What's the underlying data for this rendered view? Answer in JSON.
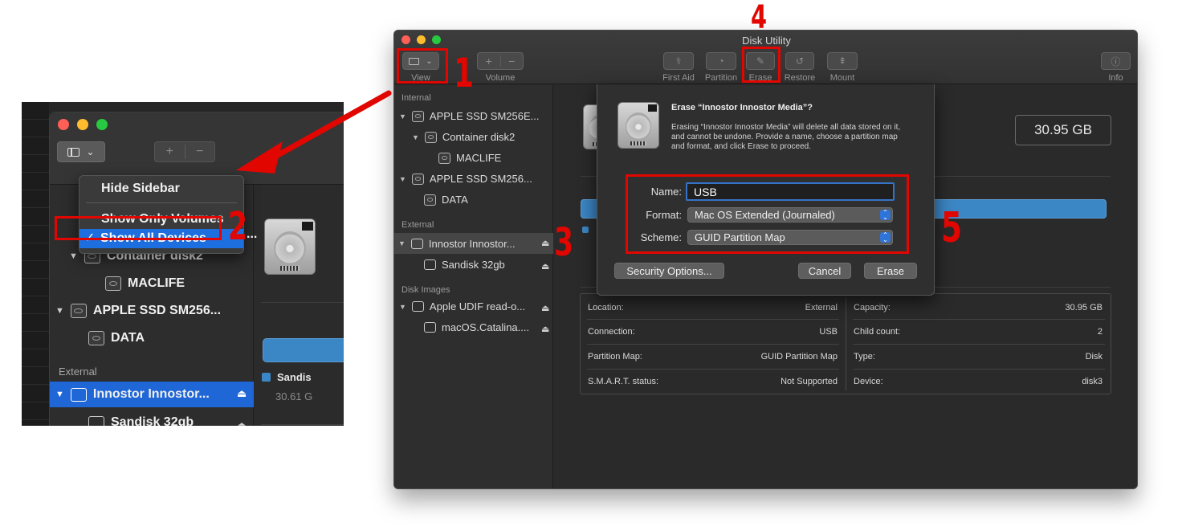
{
  "zoom": {
    "menu": {
      "items": [
        "Hide Sidebar",
        "Show Only Volumes",
        "Show All Devices"
      ],
      "checkmark": "✓"
    },
    "sidebar": {
      "items": [
        {
          "label": "Container disk2"
        },
        {
          "label": "MACLIFE"
        },
        {
          "label": "APPLE SSD SM256..."
        },
        {
          "label": "DATA"
        }
      ],
      "external_header": "External",
      "external_items": [
        {
          "label": "Innostor Innostor..."
        },
        {
          "label": "Sandisk 32gb"
        }
      ],
      "ellipsis": "..."
    },
    "content": {
      "volume_label": "Sandis",
      "size_partial": "30.61 G"
    }
  },
  "window": {
    "title": "Disk Utility",
    "toolbar": {
      "view_label": "View",
      "volume_label": "Volume",
      "plus": "+",
      "minus": "−",
      "first_aid": "First Aid",
      "partition": "Partition",
      "erase": "Erase",
      "restore": "Restore",
      "mount": "Mount",
      "info": "Info"
    },
    "sidebar": {
      "internal_header": "Internal",
      "internal_items": [
        {
          "label": "APPLE SSD SM256E..."
        },
        {
          "label": "Container disk2"
        },
        {
          "label": "MACLIFE"
        },
        {
          "label": "APPLE SSD SM256..."
        },
        {
          "label": "DATA"
        }
      ],
      "external_header": "External",
      "external_items": [
        {
          "label": "Innostor Innostor..."
        },
        {
          "label": "Sandisk 32gb"
        }
      ],
      "images_header": "Disk Images",
      "image_items": [
        {
          "label": "Apple UDIF read-o..."
        },
        {
          "label": "macOS.Catalina...."
        }
      ]
    },
    "content": {
      "capacity_box": "30.95 GB",
      "info": [
        {
          "label": "Location:",
          "value": "External",
          "label2": "Capacity:",
          "value2": "30.95 GB"
        },
        {
          "label": "Connection:",
          "value": "USB",
          "label2": "Child count:",
          "value2": "2"
        },
        {
          "label": "Partition Map:",
          "value": "GUID Partition Map",
          "label2": "Type:",
          "value2": "Disk"
        },
        {
          "label": "S.M.A.R.T. status:",
          "value": "Not Supported",
          "label2": "Device:",
          "value2": "disk3"
        }
      ]
    }
  },
  "dialog": {
    "title": "Erase “Innostor Innostor Media”?",
    "text": "Erasing “Innostor Innostor Media” will delete all data stored on it, and cannot be undone. Provide a name, choose a partition map and format, and click Erase to proceed.",
    "name_label": "Name:",
    "name_value": "USB",
    "format_label": "Format:",
    "format_value": "Mac OS Extended (Journaled)",
    "scheme_label": "Scheme:",
    "scheme_value": "GUID Partition Map",
    "security_button": "Security Options...",
    "cancel_button": "Cancel",
    "erase_button": "Erase"
  },
  "annotations": {
    "steps": [
      "1",
      "2",
      "3",
      "4",
      "5"
    ],
    "color": "#e10600"
  }
}
